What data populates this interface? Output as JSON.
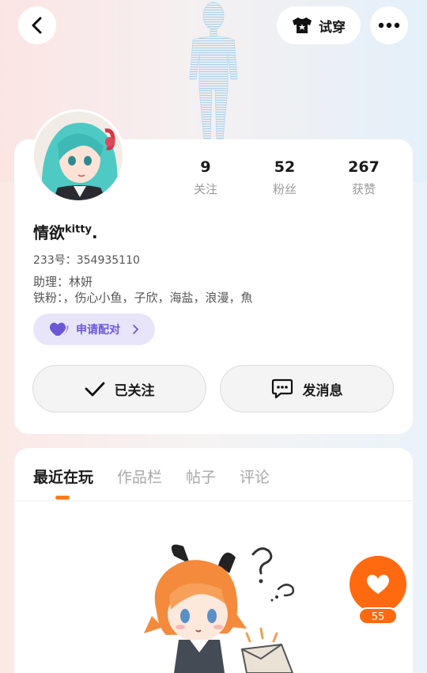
{
  "header": {
    "tryon_label": "试穿",
    "icons": {
      "back": "back-arrow-icon",
      "tryon": "tshirt-icon",
      "more": "more-dots-icon"
    }
  },
  "profile": {
    "nickname": "情欲",
    "nickname_sup": "kitty",
    "nickname_suffix": ".",
    "uid_text": "233号：354935110",
    "assistant_line": "助理：林妍",
    "fans_line": "铁粉：，伤心小鱼，子欣，海盐，浪漫，魚",
    "stats": [
      {
        "value": "9",
        "label": "关注"
      },
      {
        "value": "52",
        "label": "粉丝"
      },
      {
        "value": "267",
        "label": "获赞"
      }
    ],
    "pair_label": "申请配对",
    "follow_label": "已关注",
    "message_label": "发消息"
  },
  "tabs": [
    {
      "label": "最近在玩",
      "active": true
    },
    {
      "label": "作品栏",
      "active": false
    },
    {
      "label": "帖子",
      "active": false
    },
    {
      "label": "评论",
      "active": false
    }
  ],
  "like": {
    "count": "55"
  },
  "colors": {
    "accent": "#ff6a10",
    "pair": "#6a58d8",
    "tab_underline": "#ff7a1a"
  }
}
